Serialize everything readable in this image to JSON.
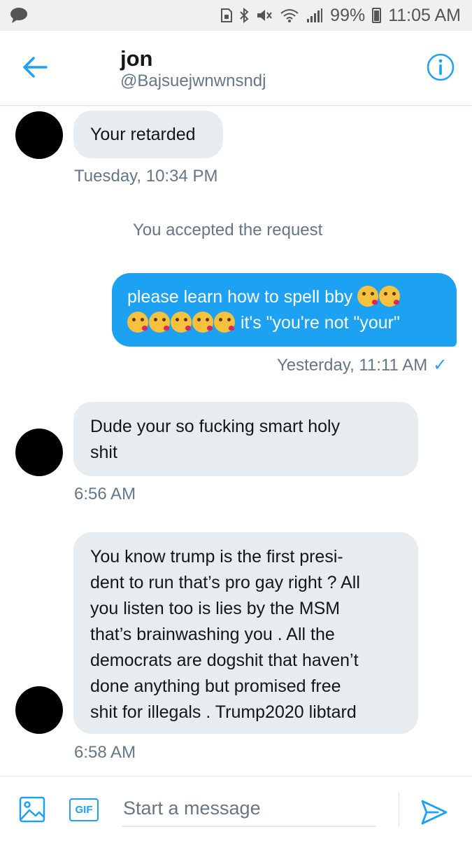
{
  "status_bar": {
    "battery": "99%",
    "time": "11:05 AM",
    "icons": [
      "chat-bubble-icon",
      "sim-icon",
      "bluetooth-icon",
      "mute-icon",
      "wifi-icon",
      "signal-icon",
      "battery-icon"
    ]
  },
  "header": {
    "name": "jon",
    "handle": "@Bajsuejwnwnsndj",
    "back_icon": "back-arrow-icon",
    "info_icon": "info-icon"
  },
  "conversation": {
    "msg1": {
      "text": "Your retarded",
      "time": "Tuesday, 10:34 PM"
    },
    "system": "You accepted the request",
    "msg2": {
      "line1_text": "please learn how to spell bby",
      "line2_text": " it's \"you're  not \"your\"",
      "emoji_name": "face-blowing-kiss-emoji",
      "time": "Yesterday, 11:11 AM",
      "read_mark": "✓"
    },
    "msg3": {
      "line1": "Dude your so fucking smart holy",
      "line2": "shit",
      "time": "6:56 AM"
    },
    "msg4": {
      "lines": [
        "You know trump is the first presi-",
        "dent to run that’s pro gay right ? All",
        "you listen too is lies by the MSM",
        "that’s brainwashing you . All the",
        "democrats are dogshit that haven’t",
        "done anything but promised free",
        "shit for illegals . Trump2020 libtard"
      ],
      "time": "6:58 AM"
    }
  },
  "composer": {
    "placeholder": "Start a message",
    "gif_label": "GIF",
    "media_icon": "image-icon",
    "send_icon": "send-icon"
  },
  "colors": {
    "accent": "#1da1f2",
    "bubble_in": "#e6ecf0",
    "muted_text": "#657786",
    "status_bar_bg": "#f0f0f0"
  }
}
